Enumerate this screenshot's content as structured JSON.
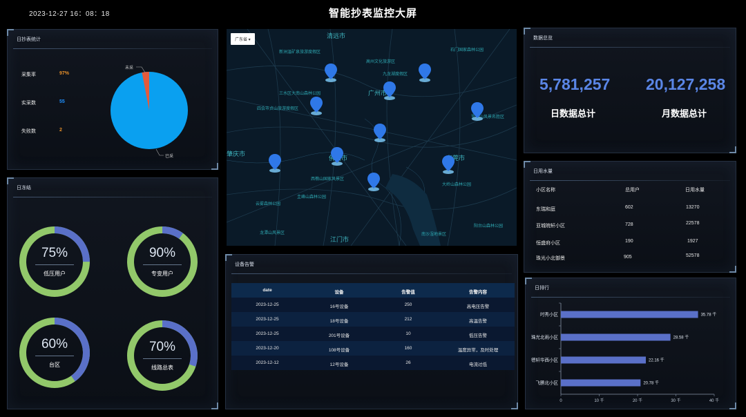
{
  "header": {
    "datetime": "2023-12-27  16：08：18",
    "title": "智能抄表监控大屏"
  },
  "daily_stats": {
    "title": "日抄表统计",
    "rows": [
      {
        "label": "采集率",
        "value": "97%",
        "color": "#e8902a"
      },
      {
        "label": "实采数",
        "value": "55",
        "color": "#1e90ff"
      },
      {
        "label": "失败数",
        "value": "2",
        "color": "#e8902a"
      }
    ],
    "pie_labels": {
      "uncollected": "未采",
      "collected": "已采"
    },
    "pie_colors": {
      "collected": "#0aa0f0",
      "uncollected": "#e55a3b"
    }
  },
  "daily_freeze": {
    "title": "日冻结",
    "rings": [
      {
        "pct": "75%",
        "value": 0.75,
        "label": "低压用户"
      },
      {
        "pct": "90%",
        "value": 0.9,
        "label": "专变用户"
      },
      {
        "pct": "60%",
        "value": 0.6,
        "label": "台区"
      },
      {
        "pct": "70%",
        "value": 0.7,
        "label": "线路总表"
      }
    ],
    "colors": {
      "fill": "#5a70c8",
      "track": "#92c86a"
    }
  },
  "map": {
    "region_select": "广东省 ▾",
    "labels": [
      {
        "text": "清远市",
        "big": true
      },
      {
        "text": "肇庆市",
        "big": true
      },
      {
        "text": "佛山市",
        "big": true
      },
      {
        "text": "广州市",
        "big": true
      },
      {
        "text": "东莞市",
        "big": true
      },
      {
        "text": "江门市",
        "big": true
      },
      {
        "text": "高州文化旅游区"
      },
      {
        "text": "九龙湖度假区"
      },
      {
        "text": "石门国家森林公园"
      },
      {
        "text": "三水区大南山森林公园"
      },
      {
        "text": "四会市贞山旅游度假区"
      },
      {
        "text": "西樵山国家风景区"
      },
      {
        "text": "云雾森林公园"
      },
      {
        "text": "龙潭山风景区"
      },
      {
        "text": "大岭山森林公园"
      },
      {
        "text": "南沙湿地景区"
      },
      {
        "text": "阳台山森林公园"
      },
      {
        "text": "新洲温矿泉旅游度假区"
      },
      {
        "text": "罗浮山风景名胜区"
      },
      {
        "text": "圭峰山森林公园"
      }
    ]
  },
  "summary": {
    "title": "数据总览",
    "daily": {
      "value": "5,781,257",
      "caption": "日数据总计"
    },
    "monthly": {
      "value": "20,127,258",
      "caption": "月数据总计"
    }
  },
  "water": {
    "title": "日用水量",
    "headers": [
      "小区名称",
      "总用户",
      "日用水量"
    ],
    "rows": [
      [
        "东瑞和庭",
        "602",
        "13270"
      ],
      [
        "亚城皖轩小区",
        "728",
        "22578"
      ],
      [
        "恒盛府小区",
        "190",
        "1927"
      ],
      [
        "珠光小北御景",
        "905",
        "52578"
      ]
    ]
  },
  "alarm": {
    "title": "设备告警",
    "headers": [
      "date",
      "设备",
      "告警值",
      "告警内容"
    ],
    "rows": [
      [
        "2023-12-25",
        "16号设备",
        "250",
        "高电压告警"
      ],
      [
        "2023-12-25",
        "18号设备",
        "212",
        "高温告警"
      ],
      [
        "2023-12-25",
        "201号设备",
        "10",
        "低压告警"
      ],
      [
        "2023-12-20",
        "108号设备",
        "160",
        "温度异常，及时处理"
      ],
      [
        "2023-12-12",
        "12号设备",
        "26",
        "电流过低"
      ]
    ]
  },
  "ranking": {
    "title": "日排行",
    "chart_data": {
      "type": "bar",
      "orientation": "horizontal",
      "categories": [
        "时秀小区",
        "珠光北雨小区",
        "德轩华西小区",
        "飞鹏北小区"
      ],
      "values": [
        35.78,
        28.58,
        22.16,
        20.78
      ],
      "value_labels": [
        "35.78 千",
        "28.58 千",
        "22.16 千",
        "20.78 千"
      ],
      "xlim": [
        0,
        40
      ],
      "ticks": [
        "0",
        "10 千",
        "20 千",
        "30 千",
        "40 千"
      ],
      "color": "#5a70c8"
    }
  }
}
